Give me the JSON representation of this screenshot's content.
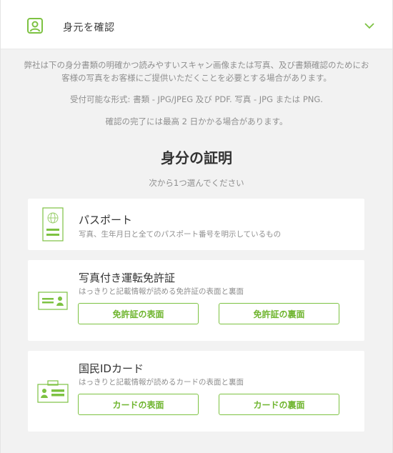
{
  "colors": {
    "accent": "#7dc242",
    "muted_text": "#8f8f8f",
    "background": "#f2f2f2"
  },
  "header": {
    "title": "身元を確認",
    "icon": "id-person-icon",
    "toggle_icon": "chevron-down-icon"
  },
  "intro": {
    "paragraph": "弊社は下の身分書類の明確かつ読みやすいスキャン画像または写真、及び書類確認のためにお客様の写真をお客様にご提供いただくことを必要とする場合があります。",
    "formats": "受付可能な形式: 書類 - JPG/JPEG 及び PDF. 写真 - JPG または PNG.",
    "note": "確認の完了には最高 2 日かかる場合があります。"
  },
  "proof": {
    "heading": "身分の証明",
    "subheading": "次から1つ選んでください"
  },
  "documents": {
    "passport": {
      "title": "パスポート",
      "description": "写真、生年月日と全てのパスポート番号を明示しているもの",
      "icon": "passport-icon"
    },
    "license": {
      "title": "写真付き運転免許証",
      "description": "はっきりと記載情報が読める免許証の表面と裏面",
      "icon": "driver-license-icon",
      "front_button": "免許証の表面",
      "back_button": "免許証の裏面"
    },
    "id_card": {
      "title": "国民IDカード",
      "description": "はっきりと記載情報が読めるカードの表面と裏面",
      "icon": "id-card-icon",
      "front_button": "カードの表面",
      "back_button": "カードの裏面"
    }
  }
}
